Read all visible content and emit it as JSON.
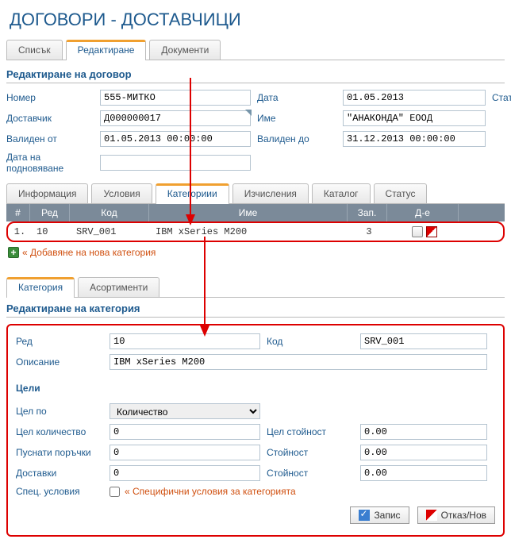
{
  "title": "ДОГОВОРИ - ДОСТАВЧИЦИ",
  "mainTabs": {
    "list": "Списък",
    "edit": "Редактиране",
    "docs": "Документи"
  },
  "editHeader": "Редактиране на договор",
  "labels": {
    "number": "Номер",
    "date": "Дата",
    "status": "Статус",
    "supplier": "Доставчик",
    "name": "Име",
    "validFrom": "Валиден от",
    "validTo": "Валиден до",
    "renewDate": "Дата на подновяване"
  },
  "values": {
    "number": "555-МИТКО",
    "date": "01.05.2013",
    "supplier": "Д000000017",
    "name": "\"АНАКОНДА\" ЕООД",
    "validFrom": "01.05.2013 00:00:00",
    "validTo": "31.12.2013 00:00:00",
    "renewDate": ""
  },
  "subTabs": {
    "info": "Информация",
    "terms": "Условия",
    "cats": "Категориии",
    "calc": "Изчисления",
    "catalog": "Каталог",
    "status": "Статус"
  },
  "gridHeaders": {
    "num": "#",
    "ord": "Ред",
    "code": "Код",
    "name": "Име",
    "qty": "Зап.",
    "act": "Д-е"
  },
  "gridRow": {
    "num": "1.",
    "ord": "10",
    "code": "SRV_001",
    "name": "IBM xSeries M200",
    "qty": "3"
  },
  "addNew": "« Добавяне на нова категория",
  "btmTabs": {
    "cat": "Категория",
    "asort": "Асортименти"
  },
  "catEditHeader": "Редактиране на категория",
  "catLabels": {
    "ord": "Ред",
    "code": "Код",
    "desc": "Описание",
    "goals": "Цели",
    "goalBy": "Цел по",
    "goalQty": "Цел количество",
    "goalVal": "Цел стойност",
    "launched": "Пуснати поръчки",
    "value": "Стойност",
    "deliveries": "Доставки",
    "spec": "Спец. условия",
    "specChk": "« Специфични условия за категорията"
  },
  "catValues": {
    "ord": "10",
    "code": "SRV_001",
    "desc": "IBM xSeries M200",
    "goalBy": "Количество",
    "goalQty": "0",
    "goalVal": "0.00",
    "launched": "0",
    "launchedVal": "0.00",
    "deliveries": "0",
    "deliveriesVal": "0.00"
  },
  "buttons": {
    "save": "Запис",
    "cancel": "Отказ/Нов"
  }
}
